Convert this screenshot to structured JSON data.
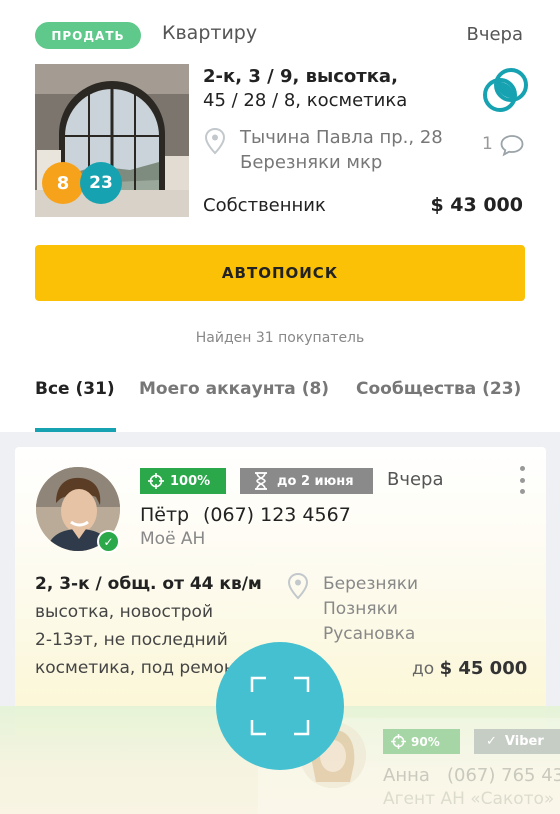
{
  "listing": {
    "badge": "ПРОДАТЬ",
    "type": "Квартиру",
    "date": "Вчера",
    "title_line1": "2-к, 3 / 9, высотка,",
    "title_line2": "45 / 28 / 8, косметика",
    "address_line1": "Тычина Павла пр., 28",
    "address_line2": "Березняки мкр",
    "comments_count": "1",
    "owner": "Собственник",
    "price": "$ 43 000",
    "photo_counts": {
      "orange": "8",
      "teal": "23"
    }
  },
  "actions": {
    "autosearch_label": "АВТОПОИСК"
  },
  "found_text": "Найден 31 покупатель",
  "tabs": [
    {
      "label": "Все (31)",
      "active": true
    },
    {
      "label": "Моего аккаунта (8)",
      "active": false
    },
    {
      "label": "Сообщества (23)",
      "active": false
    }
  ],
  "buyers": [
    {
      "match": "100%",
      "deadline": "до 2 июня",
      "date": "Вчера",
      "name": "Пётр",
      "phone": "(067) 123 4567",
      "agency": "Моё АН",
      "req_line1": "2, 3-к / общ. от 44 кв/м",
      "req_line2": "высотка, новострой",
      "req_line3": "2-13эт, не последний",
      "req_line4": "косметика, под ремонт",
      "districts": [
        "Березняки",
        "Позняки",
        "Русановка"
      ],
      "price_prefix": "до",
      "price": "$ 45 000"
    },
    {
      "match": "90%",
      "messenger": "Viber",
      "name": "Анна",
      "phone": "(067) 765 43",
      "agency": "Агент АН «Сакото»"
    }
  ],
  "colors": {
    "accent_teal": "#17a2b1",
    "sell_green": "#5ec98b",
    "autosearch_yellow": "#fbc107",
    "match_green": "#2aa84a",
    "counter_orange": "#f7a21b",
    "fab_blue": "#45c0d0"
  },
  "icons": {
    "location": "map-pin-icon",
    "comment": "speech-bubble-icon",
    "match": "crosshair-icon",
    "deadline": "hourglass-icon",
    "more": "kebab-menu-icon",
    "verified": "check-icon",
    "viber": "check-icon",
    "fullscreen": "fullscreen-corners-icon",
    "community_logo": "overlapping-circles-icon"
  }
}
